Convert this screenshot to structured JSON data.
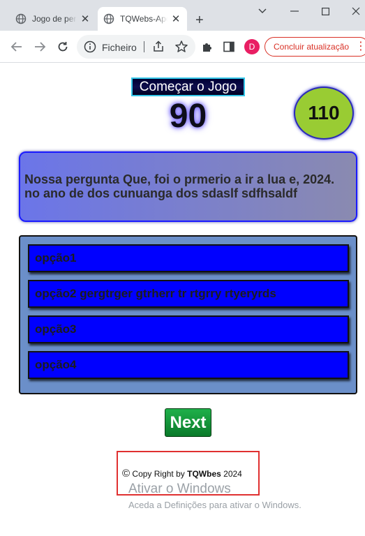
{
  "browser": {
    "tabs": [
      {
        "title": "Jogo de perguntas",
        "active": false
      },
      {
        "title": "TQWebs-Apostas",
        "active": true
      }
    ],
    "address": {
      "site_label": "Ficheiro"
    },
    "profile_initial": "D",
    "update_button_label": "Concluir atualização",
    "colors": {
      "tab_strip": "#dee1e6",
      "update_accent": "#d93025",
      "avatar": "#e91e63"
    }
  },
  "game": {
    "start_button_label": "Começar o Jogo",
    "timer_value": "90",
    "score_value": "110",
    "question": "Nossa pergunta Que, foi o prmerio a ir a lua e, 2024. no ano de dos cunuanga dos sdaslf sdfhsaldf",
    "options": [
      {
        "label": "opção1"
      },
      {
        "label": "opção2 gergtrger gtrherr tr rtgrry rtyeryrds"
      },
      {
        "label": "opção3"
      },
      {
        "label": "opção4"
      }
    ],
    "next_button_label": "Next",
    "colors": {
      "option_bg": "#0000ff",
      "options_panel": "#6b8fc9",
      "score_circle": "#99cc33",
      "next_button": "#1a9a3a"
    }
  },
  "footer": {
    "copyright_symbol": "©",
    "copyright_text": "Copy Right by",
    "brand": "TQWbes",
    "year": "2024"
  },
  "watermark": {
    "title": "Ativar o Windows",
    "subtitle": "Aceda a Definições para ativar o Windows."
  }
}
